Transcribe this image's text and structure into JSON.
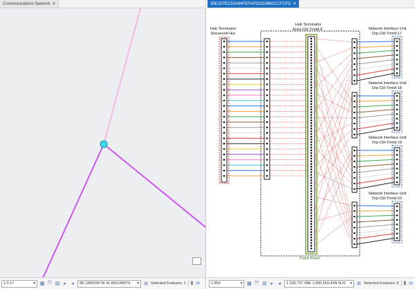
{
  "left": {
    "tab_title": "Communications Network",
    "scale": "1:0.17",
    "coordinates": "88.1380596°W 41.8551468°N",
    "selected": "Selected Features: 1"
  },
  "right": {
    "tab_title": "35E207EC33A94FEFAF82510660CCFCFD",
    "scale": "1:854",
    "coordinates": "1,036,757.99E 1,890,569.43N ftUS",
    "selected": "Selected Features: 0",
    "hub_left": {
      "line1": "Hub Terminator",
      "line2": "Roosevelt-Hut"
    },
    "hub_center": {
      "line1": "Hub Terminator",
      "line2": "Aces-Cbl-Trmtd-8"
    },
    "patch_panel_label": "Patch Panel",
    "nius": [
      {
        "line1": "Network Interface Unit",
        "line2": "Drp-Cbl-Trmtd-17"
      },
      {
        "line1": "Network Interface Unit",
        "line2": "Drp-Cbl-Trmtd-18"
      },
      {
        "line1": "Network Interface Unit",
        "line2": "Drp-Cbl-Trmtd-19"
      },
      {
        "line1": "Network Interface Unit",
        "line2": "Drp-Cbl-Trmtd-20"
      }
    ]
  },
  "colors": {
    "accent": "#1b6ec2",
    "junction": "#3ad7e6",
    "line_magenta": "#cc55ee",
    "line_pink": "#f5b8e6",
    "patch_panel": "#7aa83a",
    "hub_border_red": "#d42a2a",
    "niu_border_blue": "#2a5aa8",
    "dotted_red": "#d44"
  },
  "icons": [
    "dropdown-icon",
    "grid-icon",
    "extent-icon",
    "table-icon",
    "forward-icon",
    "navigate-icon",
    "pause-icon",
    "refresh-icon",
    "close-icon",
    "overview-icon"
  ]
}
